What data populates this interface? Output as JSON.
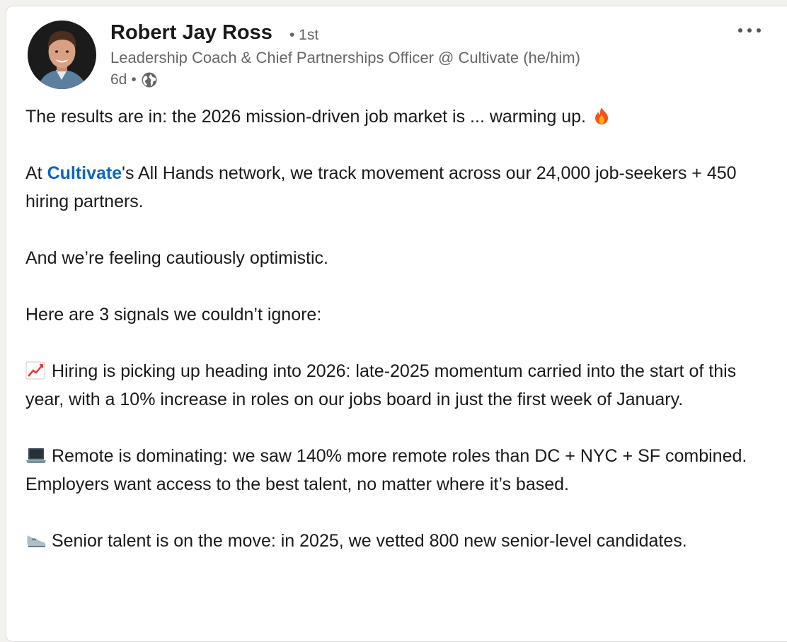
{
  "author": {
    "name": "Robert Jay Ross",
    "degree": "• 1st",
    "headline": "Leadership Coach & Chief Partnerships Officer @ Cultivate (he/him)",
    "time": "6d",
    "visibility_icon": "globe-icon"
  },
  "menu": {
    "icon": "more-options-icon"
  },
  "post": {
    "p1": "The results are in: the 2026 mission-driven job market is ... warming up.",
    "p1_icon": "fire-icon",
    "p2_pre": "At ",
    "p2_mention": "Cultivate",
    "p2_post": "'s All Hands network, we track movement across our 24,000 job-seekers + 450 hiring partners.",
    "p3": "And we’re feeling cautiously optimistic.",
    "p4": "Here are 3 signals we couldn’t ignore:",
    "p5_icon": "chart-increasing-icon",
    "p5": "Hiring is picking up heading into 2026: late-2025 momentum carried into the start of this year, with a 10% increase in roles on our jobs board in just the first week of January.",
    "p6_icon": "laptop-icon",
    "p6": "Remote is dominating: we saw 140% more remote roles than DC + NYC + SF combined. Employers want access to the best talent, no matter where it’s based.",
    "p7_icon": "sneaker-icon",
    "p7": "Senior talent is on the move: in 2025, we vetted 800 new senior-level candidates."
  },
  "colors": {
    "link": "#0a66c2",
    "text": "#191919",
    "secondary": "#666666"
  }
}
